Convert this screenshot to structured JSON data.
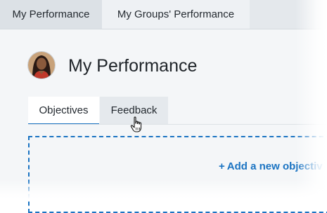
{
  "top_tabs": [
    {
      "label": "My Performance",
      "active": true
    },
    {
      "label": "My Groups' Performance",
      "active": false
    }
  ],
  "page": {
    "title": "My Performance"
  },
  "sub_tabs": [
    {
      "label": "Objectives",
      "active": true
    },
    {
      "label": "Feedback",
      "active": false,
      "hovered": true
    }
  ],
  "empty_state": {
    "add_icon": "+",
    "add_label": "Add a new objectiv"
  },
  "colors": {
    "accent": "#1a73c2",
    "header_bg": "#e4e8ec",
    "content_bg": "#f4f6f8"
  },
  "icons": {
    "avatar": "user-avatar-photo",
    "cursor": "hand-pointer-icon"
  }
}
